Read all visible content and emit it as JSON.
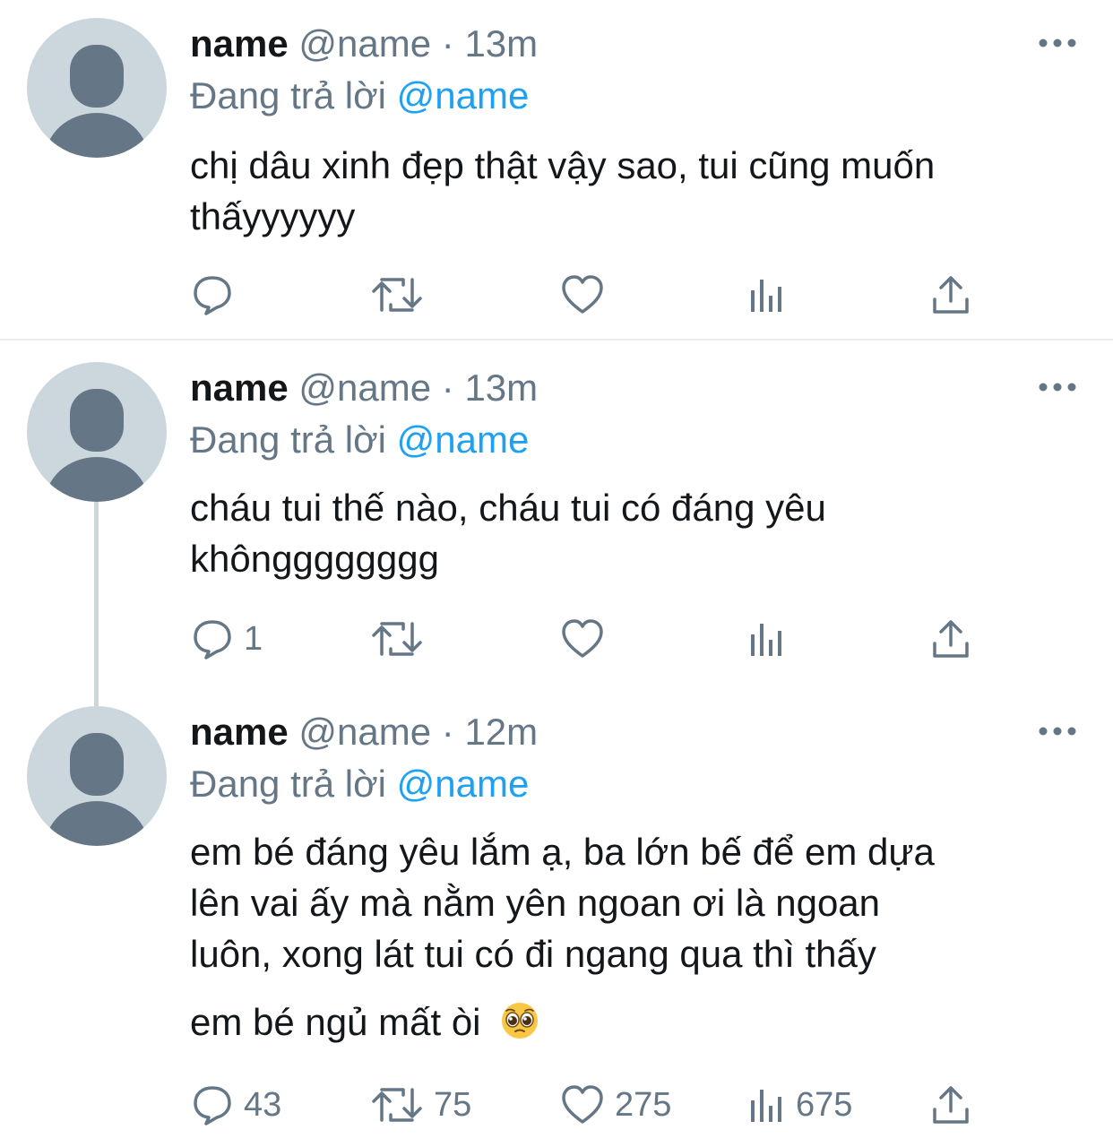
{
  "tweets": [
    {
      "display_name": "name",
      "handle": "@name",
      "separator": "·",
      "time": "13m",
      "reply_prefix": "Đang trả lời",
      "reply_mention": "@name",
      "text_lines": [
        "chị dâu xinh đẹp thật vậy sao, tui cũng muốn",
        "thấyyyyyy"
      ],
      "counts": {
        "reply": "",
        "retweet": "",
        "like": "",
        "views": ""
      }
    },
    {
      "display_name": "name",
      "handle": "@name",
      "separator": "·",
      "time": "13m",
      "reply_prefix": "Đang trả lời",
      "reply_mention": "@name",
      "text_lines": [
        "cháu tui thế nào, cháu tui có đáng yêu",
        "khôngggggggg"
      ],
      "counts": {
        "reply": "1",
        "retweet": "",
        "like": "",
        "views": ""
      }
    },
    {
      "display_name": "name",
      "handle": "@name",
      "separator": "·",
      "time": "12m",
      "reply_prefix": "Đang trả lời",
      "reply_mention": "@name",
      "text_lines": [
        "em bé đáng yêu lắm ạ, ba lớn bế để em dựa",
        "lên vai ấy mà nằm yên ngoan ơi là ngoan",
        "luôn, xong lát tui có đi ngang qua thì thấy",
        "em bé ngủ mất òi"
      ],
      "emoji": "pleading-face-emoji",
      "counts": {
        "reply": "43",
        "retweet": "75",
        "like": "275",
        "views": "675"
      }
    }
  ],
  "icons": {
    "avatar": "default-avatar-icon",
    "more": "more-horizontal-icon",
    "reply": "reply-bubble-icon",
    "retweet": "retweet-icon",
    "like": "heart-icon",
    "views": "analytics-bars-icon",
    "share": "share-upload-icon"
  },
  "colors": {
    "text": "#14171a",
    "secondary": "#657786",
    "mention": "#1da1f2",
    "avatar_bg": "#ccd6dd",
    "avatar_fg": "#657786",
    "divider": "#e6ecf0"
  }
}
